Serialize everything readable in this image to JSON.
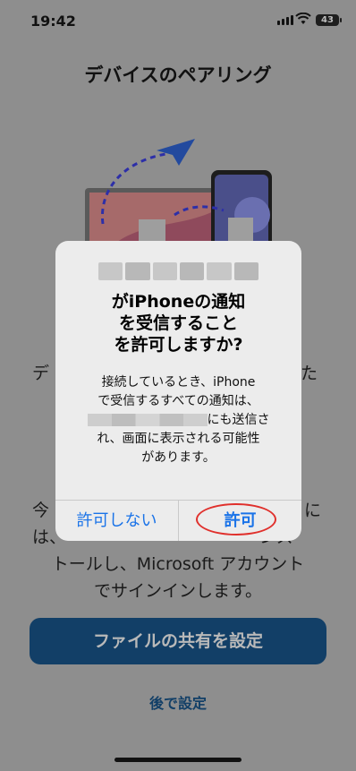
{
  "status_bar": {
    "time": "19:42",
    "battery": "43"
  },
  "page": {
    "title": "デバイスのペアリング",
    "body_left_1": "デ",
    "body_right_1": "た",
    "body_left_2": "今",
    "body_right_2": "に",
    "body_left_3": "は、",
    "body_right_3": "ンス",
    "body_line_4": "トールし、Microsoft アカウント",
    "body_line_5": "でサインインします。",
    "primary_button": "ファイルの共有を設定",
    "later_link": "後で設定"
  },
  "alert": {
    "title_lines": [
      "がiPhoneの通知",
      "を受信すること",
      "を許可しますか?"
    ],
    "message_line1": "接続しているとき、iPhone",
    "message_line2": "で受信するすべての通知は、",
    "message_line3_suffix": "にも送信さ",
    "message_line4": "れ、画面に表示される可能性",
    "message_line5": "があります。",
    "deny_label": "許可しない",
    "allow_label": "許可"
  },
  "colors": {
    "accent": "#1a73e8",
    "highlight_circle": "#e0302c",
    "primary_button": "#123f67"
  },
  "icons": [
    "signal-icon",
    "wifi-icon",
    "battery-icon",
    "paper-plane-icon",
    "laptop-icon",
    "phone-icon",
    "document-icon"
  ]
}
